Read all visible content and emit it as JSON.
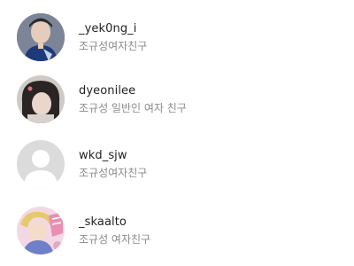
{
  "friends": [
    {
      "username": "_yek0ng_i",
      "subtitle": "조규성여자친구",
      "avatar_icon": "profile-photo"
    },
    {
      "username": "dyeonilee",
      "subtitle": "조규성 일반인 여자 친구",
      "avatar_icon": "profile-photo"
    },
    {
      "username": "wkd_sjw",
      "subtitle": "조규성여자친구",
      "avatar_icon": "default-avatar"
    },
    {
      "username": "_skaalto",
      "subtitle": "조규성 여자친구",
      "avatar_icon": "profile-photo"
    }
  ],
  "colors": {
    "username": "#1f1f1f",
    "subtitle": "#8a8a8a",
    "default_avatar_bg": "#dbdbdb"
  }
}
